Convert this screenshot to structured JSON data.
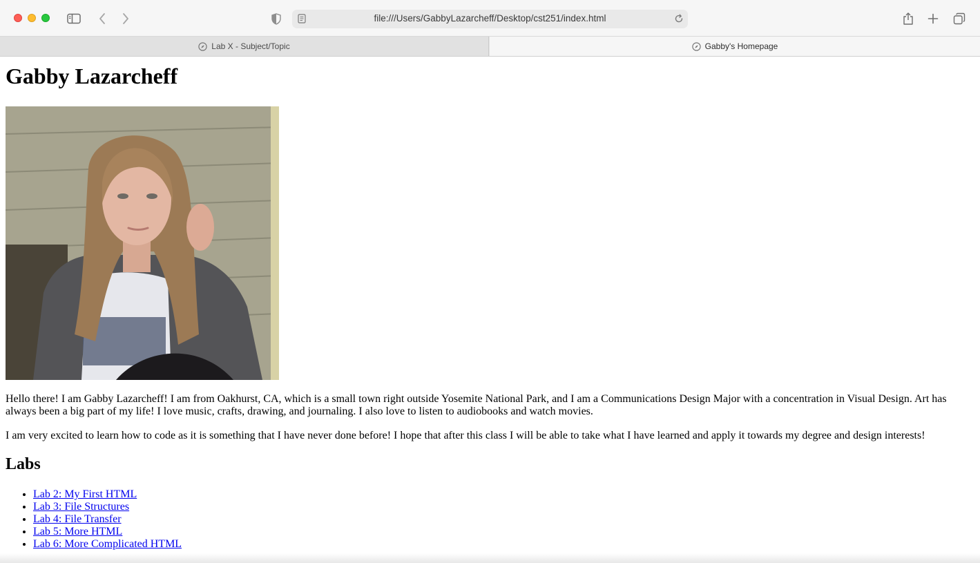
{
  "browser": {
    "url": "file:///Users/GabbyLazarcheff/Desktop/cst251/index.html",
    "tabs": [
      {
        "label": "Lab X - Subject/Topic",
        "active": false
      },
      {
        "label": "Gabby's Homepage",
        "active": true
      }
    ],
    "icons": {
      "sidebar": "sidebar-icon",
      "back": "chevron-left-icon",
      "forward": "chevron-right-icon",
      "privacy": "shield-icon",
      "page": "page-icon",
      "reload": "reload-icon",
      "share": "share-icon",
      "new_tab": "plus-icon",
      "tab_overview": "tab-overview-icon",
      "tab_favicon": "compass-icon"
    },
    "colors": {
      "close": "#fe5f57",
      "minimize": "#febc2e",
      "maximize": "#28c840"
    }
  },
  "page": {
    "title": "Gabby Lazarcheff",
    "intro": "Hello there! I am Gabby Lazarcheff! I am from Oakhurst, CA, which is a small town right outside Yosemite National Park, and I am a Communications Design Major with a concentration in Visual Design. Art has always been a big part of my life! I love music, crafts, drawing, and journaling. I also love to listen to audiobooks and watch movies.",
    "excitement": "I am very excited to learn how to code as it is something that I have never done before! I hope that after this class I will be able to take what I have learned and apply it towards my degree and design interests!",
    "labs_heading": "Labs",
    "labs": [
      {
        "label": "Lab 2: My First HTML"
      },
      {
        "label": "Lab 3: File Structures"
      },
      {
        "label": "Lab 4: File Transfer"
      },
      {
        "label": "Lab 5: More HTML"
      },
      {
        "label": "Lab 6: More Complicated HTML"
      }
    ],
    "link_color": "#0000ee"
  }
}
